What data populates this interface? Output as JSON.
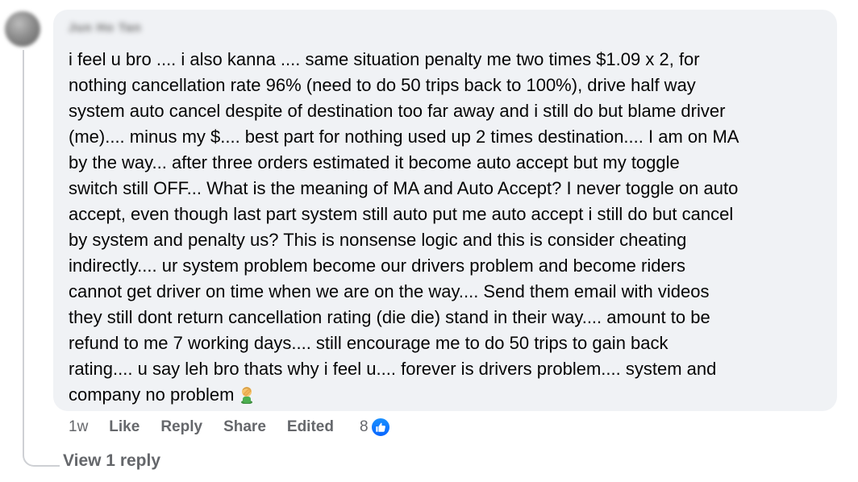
{
  "comment": {
    "author_name": "Jun Ho Tan",
    "lines": [
      "i feel u bro .... i also kanna .... same situation penalty me two times $1.09 x 2, for",
      "nothing cancellation rate 96% (need to do 50 trips back to 100%), drive half way",
      "system auto cancel despite of destination too far away and i still do but blame driver",
      "(me).... minus my $.... best part for nothing used up 2 times destination.... I am on MA",
      "by the way... after three orders estimated it become auto accept but my toggle",
      "switch still OFF... What is the meaning of MA and Auto Accept? I never toggle on auto",
      "accept, even though last part system still auto put me auto accept i still do but cancel",
      "by system and penalty us? This is nonsense logic and this is consider cheating",
      "indirectly.... ur system problem become our drivers problem and become riders",
      "cannot get driver on time when we are on the way.... Send them email with videos",
      "they still dont return cancellation rating (die die) stand in their way.... amount to be",
      "refund to me 7 working days.... still encourage me to do 50 trips to gain back",
      "rating.... u say leh bro thats why i feel u.... forever is drivers problem.... system and",
      "company no problem"
    ],
    "emoji": "man-facepalming-emoji"
  },
  "actions": {
    "time": "1w",
    "like": "Like",
    "reply": "Reply",
    "share": "Share",
    "edited": "Edited",
    "reaction_count": "8"
  },
  "replies": {
    "label": "View 1 reply"
  },
  "colors": {
    "bubble": "#f0f2f5",
    "text": "#050505",
    "meta": "#65676b",
    "like_blue": "#0866ff",
    "thread_line": "#ced0d4"
  }
}
